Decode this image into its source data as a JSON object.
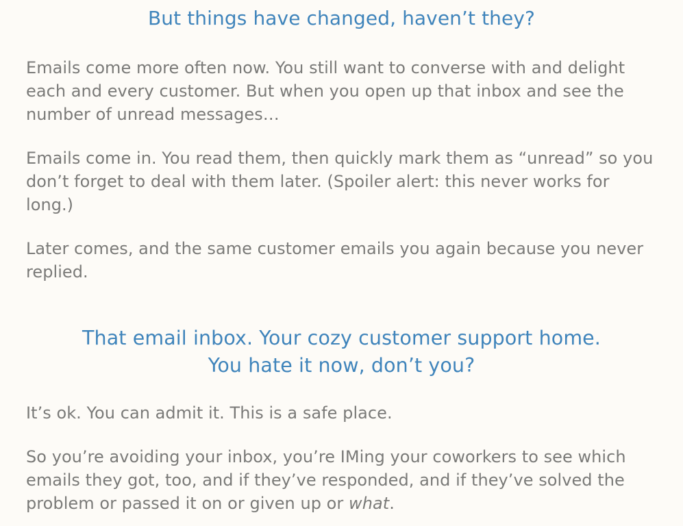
{
  "article": {
    "heading1": "But things have changed, haven’t they?",
    "paragraphs": [
      "Emails come more often now. You still want to converse with and delight each and every customer. But when you open up that inbox and see the number of unread messages…",
      "Emails come in. You read them, then quickly mark them as “unread” so you don’t forget to deal with them later. (Spoiler alert: this never works for long.)",
      "Later comes, and the same customer emails you again because you never replied."
    ],
    "heading2_line1": "That email inbox. Your cozy customer support home.",
    "heading2_line2": "You hate it now, don’t you?",
    "paragraph4": "It’s ok. You can admit it. This is a safe place.",
    "paragraph5_main": "So you’re avoiding your inbox, you’re IMing your coworkers to see which emails they got, too, and if they’ve responded, and if they’ve solved the problem or passed it on or given up or ",
    "paragraph5_emphasis": "what",
    "paragraph5_end": "."
  },
  "colors": {
    "background": "#fdfbf7",
    "heading": "#3f84bb",
    "body_text": "#7a7a78"
  }
}
